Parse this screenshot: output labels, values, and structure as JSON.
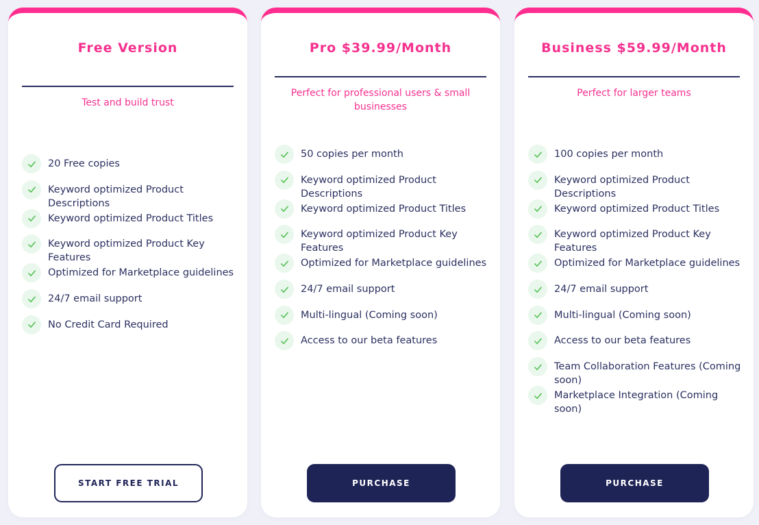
{
  "colors": {
    "accent": "#f5318f",
    "navy": "#1f2457",
    "check": "#4cbf4c",
    "background": "#f0f1f8"
  },
  "plans": [
    {
      "title": "Free Version",
      "subtitle": "Test and build trust",
      "features": [
        "20 Free copies",
        "Keyword optimized Product Descriptions",
        "Keyword optimized Product Titles",
        "Keyword optimized Product Key Features",
        "Optimized for Marketplace guidelines",
        "24/7 email support",
        "No Credit Card Required"
      ],
      "button": "START FREE TRIAL"
    },
    {
      "title": "Pro $39.99/Month",
      "subtitle": "Perfect for professional users & small businesses",
      "features": [
        "50 copies per month",
        "Keyword optimized Product Descriptions",
        "Keyword optimized Product Titles",
        "Keyword optimized Product Key Features",
        "Optimized for Marketplace guidelines",
        "24/7 email support",
        "Multi-lingual (Coming soon)",
        "Access to our beta features"
      ],
      "button": "PURCHASE"
    },
    {
      "title": "Business $59.99/Month",
      "subtitle": "Perfect for larger teams",
      "features": [
        "100 copies per month",
        "Keyword optimized Product Descriptions",
        "Keyword optimized Product Titles",
        "Keyword optimized Product Key Features",
        "Optimized for Marketplace guidelines",
        "24/7 email support",
        "Multi-lingual (Coming soon)",
        "Access to our beta features",
        "Team Collaboration Features (Coming soon)",
        "Marketplace Integration (Coming soon)"
      ],
      "button": "PURCHASE"
    }
  ]
}
